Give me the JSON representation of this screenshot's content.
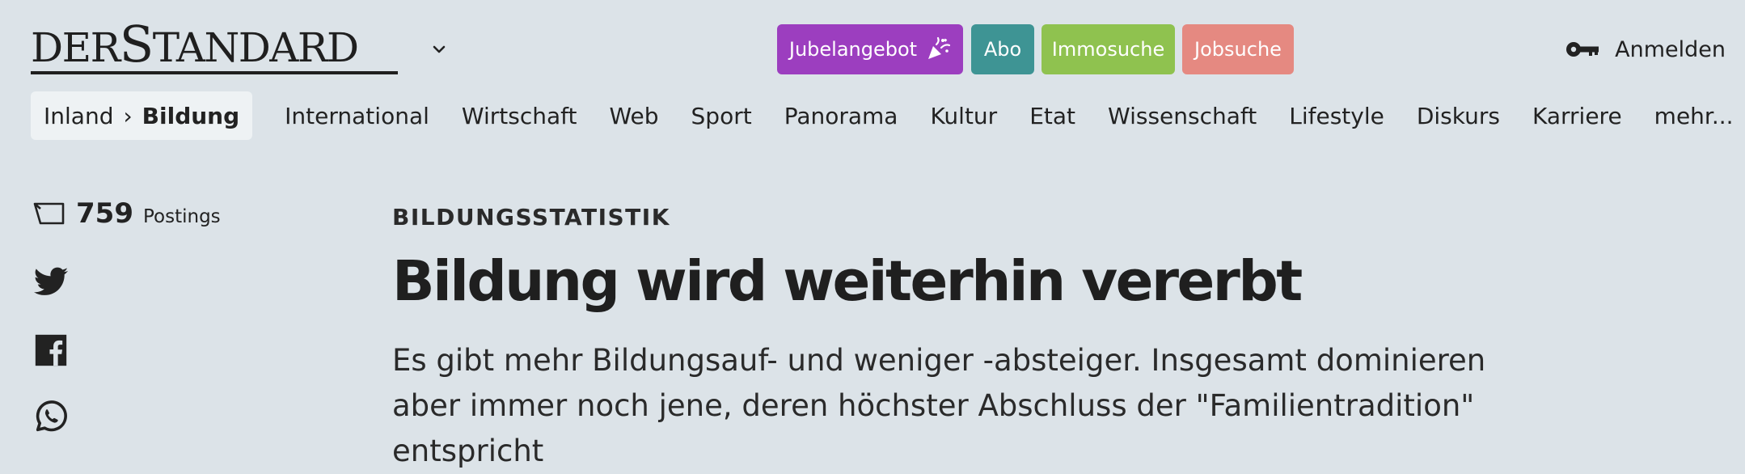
{
  "header": {
    "logo_part1": "DER",
    "logo_s": "S",
    "logo_part2": "TANDARD",
    "promos": [
      {
        "label": "Jubelangebot",
        "color": "#9c3ebf"
      },
      {
        "label": "Abo",
        "color": "#3e9494"
      },
      {
        "label": "Immosuche",
        "color": "#8fc24f"
      },
      {
        "label": "Jobsuche",
        "color": "#e58981"
      }
    ],
    "login_label": "Anmelden"
  },
  "nav": {
    "breadcrumb": {
      "parent": "Inland",
      "separator": "›",
      "current": "Bildung"
    },
    "items": [
      "International",
      "Wirtschaft",
      "Web",
      "Sport",
      "Panorama",
      "Kultur",
      "Etat",
      "Wissenschaft",
      "Lifestyle",
      "Diskurs",
      "Karriere",
      "mehr..."
    ]
  },
  "article": {
    "postings_count": "759",
    "postings_label": "Postings",
    "kicker": "BILDUNGSSTATISTIK",
    "headline": "Bildung wird weiterhin vererbt",
    "lead": "Es gibt mehr Bildungsauf- und weniger -absteiger. Insgesamt dominieren aber immer noch jene, deren höchster Abschluss der \"Familientradition\" entspricht"
  },
  "icons": {
    "login": "key-icon",
    "menu": "chevron-down-icon",
    "postings": "comment-icon",
    "share": [
      "twitter-icon",
      "facebook-icon",
      "whatsapp-icon"
    ],
    "promo": "party-popper-icon"
  }
}
